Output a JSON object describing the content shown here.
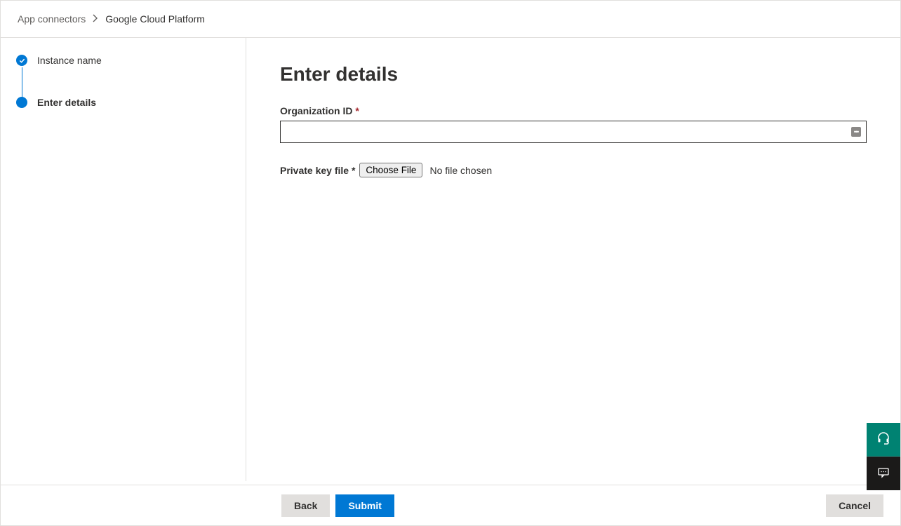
{
  "breadcrumb": {
    "parent": "App connectors",
    "current": "Google Cloud Platform"
  },
  "sidebar": {
    "steps": [
      {
        "label": "Instance name"
      },
      {
        "label": "Enter details"
      }
    ]
  },
  "main": {
    "title": "Enter details",
    "org_id_label": "Organization ID",
    "org_id_value": "",
    "private_key_label": "Private key file",
    "choose_file_button": "Choose File",
    "file_status": "No file chosen"
  },
  "footer": {
    "back": "Back",
    "submit": "Submit",
    "cancel": "Cancel"
  }
}
